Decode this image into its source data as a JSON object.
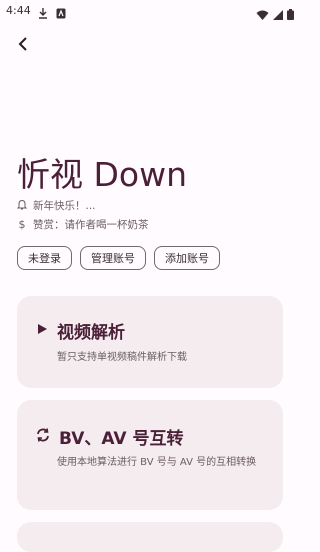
{
  "status": {
    "time": "4:44"
  },
  "app_title": "忻视 Down",
  "notice": "新年快乐！...",
  "donate": "赞赏：请作者喝一杯奶茶",
  "chips": [
    "未登录",
    "管理账号",
    "添加账号"
  ],
  "cards": [
    {
      "title": "视频解析",
      "desc": "暂只支持单视频稿件解析下载",
      "icon": "play-icon"
    },
    {
      "title": "BV、AV 号互转",
      "desc": "使用本地算法进行 BV 号与 AV 号的互相转换",
      "icon": "sync-icon"
    }
  ],
  "colors": {
    "accent": "#4a1f37",
    "card_bg": "#f4ecee",
    "page_bg": "#fffbff"
  }
}
